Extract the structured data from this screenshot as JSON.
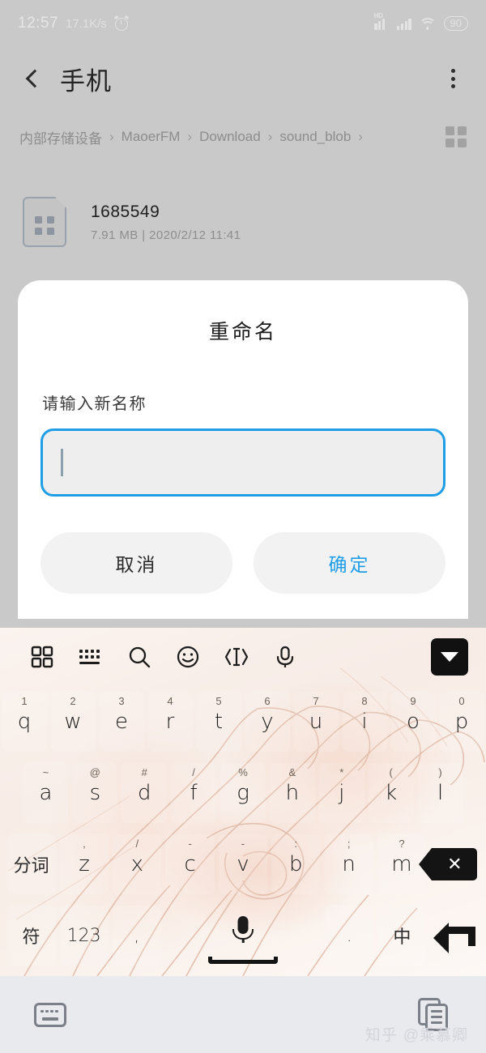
{
  "statusbar": {
    "time": "12:57",
    "network_speed": "17.1K/s",
    "alarm_icon": "alarm-clock-icon",
    "hd_label": "HD",
    "signal_icon": "signal-bars-icon",
    "signal2_icon": "signal-bars-icon",
    "wifi_icon": "wifi-icon",
    "battery_level": "90"
  },
  "appbar": {
    "back_icon": "back-chevron-icon",
    "title": "手机",
    "overflow_icon": "more-vertical-icon"
  },
  "breadcrumb": {
    "segments": [
      "内部存储设备",
      "MaoerFM",
      "Download",
      "sound_blob"
    ],
    "separator": "›",
    "trailing_separator": "›",
    "grid_toggle_icon": "grid-view-icon"
  },
  "file": {
    "name": "1685549",
    "meta": "7.91 MB  |  2020/2/12 11:41",
    "icon": "file-generic-icon"
  },
  "dialog": {
    "title": "重命名",
    "label": "请输入新名称",
    "input_value": "",
    "input_placeholder": "",
    "cancel_label": "取消",
    "confirm_label": "确定",
    "accent_color": "#1f9ee8"
  },
  "keyboard": {
    "toolbar": [
      {
        "name": "panel-grid-icon",
        "glyph": "grid"
      },
      {
        "name": "keyboard-icon",
        "glyph": "keyboard"
      },
      {
        "name": "search-icon",
        "glyph": "search"
      },
      {
        "name": "emoji-icon",
        "glyph": "emoji"
      },
      {
        "name": "cursor-move-icon",
        "glyph": "cursor"
      },
      {
        "name": "voice-input-icon",
        "glyph": "mic"
      }
    ],
    "collapse_icon": "collapse-keyboard-icon",
    "row1": [
      {
        "sup": "1",
        "key": "q"
      },
      {
        "sup": "2",
        "key": "w"
      },
      {
        "sup": "3",
        "key": "e"
      },
      {
        "sup": "4",
        "key": "r"
      },
      {
        "sup": "5",
        "key": "t"
      },
      {
        "sup": "6",
        "key": "y"
      },
      {
        "sup": "7",
        "key": "u"
      },
      {
        "sup": "8",
        "key": "i"
      },
      {
        "sup": "9",
        "key": "o"
      },
      {
        "sup": "0",
        "key": "p"
      }
    ],
    "row2": [
      {
        "sup": "~",
        "key": "a"
      },
      {
        "sup": "@",
        "key": "s"
      },
      {
        "sup": "#",
        "key": "d"
      },
      {
        "sup": "/",
        "key": "f"
      },
      {
        "sup": "%",
        "key": "g"
      },
      {
        "sup": "&",
        "key": "h"
      },
      {
        "sup": "*",
        "key": "j"
      },
      {
        "sup": "(",
        "key": "k"
      },
      {
        "sup": ")",
        "key": "l"
      }
    ],
    "row3_fn_left": "分词",
    "row3": [
      {
        "sup": ",",
        "key": "z"
      },
      {
        "sup": "/",
        "key": "x"
      },
      {
        "sup": "-",
        "key": "c"
      },
      {
        "sup": "-",
        "key": "v"
      },
      {
        "sup": ":",
        "key": "b"
      },
      {
        "sup": ";",
        "key": "n"
      },
      {
        "sup": "?",
        "key": "m"
      }
    ],
    "backspace_icon": "backspace-icon",
    "row4": {
      "symbol_key": "符",
      "number_key": "123",
      "comma_key": ",",
      "space_mic_icon": "space-mic-icon",
      "period_key": ".",
      "lang_key": "中",
      "enter_icon": "enter-icon"
    }
  },
  "navbar": {
    "keyboard_icon": "keyboard-toggle-icon",
    "clipboard_icon": "clipboard-icon"
  },
  "watermark": {
    "site": "知乎",
    "user": "@乘慕卿"
  }
}
